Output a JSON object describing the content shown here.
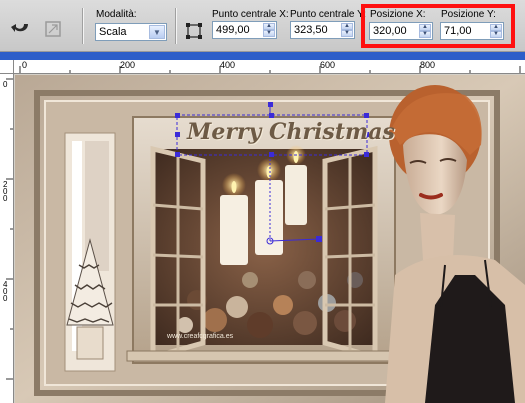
{
  "toolbar": {
    "modalita_label": "Modalità:",
    "modalita_value": "Scala",
    "punto_x_label": "Punto centrale X:",
    "punto_x_value": "499,00",
    "punto_y_label": "Punto centrale Y:",
    "punto_y_value": "323,50",
    "pos_x_label": "Posizione X:",
    "pos_x_value": "320,00",
    "pos_y_label": "Posizione Y:",
    "pos_y_value": "71,00"
  },
  "ruler": {
    "top_labels": [
      "0",
      "200",
      "400",
      "600",
      "800"
    ],
    "left_labels": [
      "0",
      "200",
      "400"
    ]
  },
  "canvas": {
    "title_text": "Merry Christmas",
    "watermark": "www.creafcgrafica.es"
  },
  "colors": {
    "highlight": "#ff1010",
    "accent_bar": "#2d5ec9",
    "selection": "#3b2bd8"
  }
}
